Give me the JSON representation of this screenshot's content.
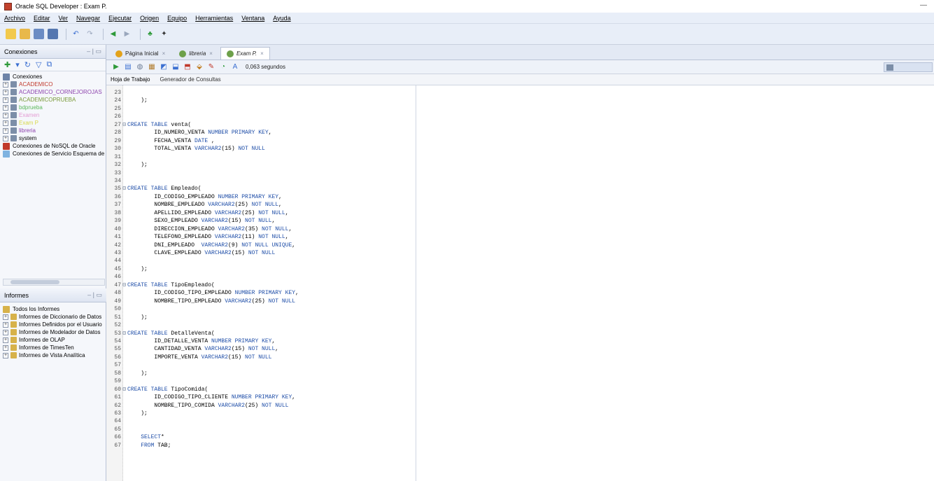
{
  "window": {
    "title": "Oracle SQL Developer : Exam P."
  },
  "menu": [
    "Archivo",
    "Editar",
    "Ver",
    "Navegar",
    "Ejecutar",
    "Origen",
    "Equipo",
    "Herramientas",
    "Ventana",
    "Ayuda"
  ],
  "connections_panel": {
    "title": "Conexiones",
    "root": "Conexiones",
    "items": [
      {
        "label": "ACADEMICO",
        "color": "#c0392b"
      },
      {
        "label": "ACADEMICO_CORNEJOROJAS",
        "color": "#8e44ad"
      },
      {
        "label": "ACADEMICOPRUEBA",
        "color": "#7a9a3a"
      },
      {
        "label": "bdprueba",
        "color": "#5cb85c"
      },
      {
        "label": "Examen",
        "color": "#e39bd3"
      },
      {
        "label": "Exam P",
        "color": "#d8d84a"
      },
      {
        "label": "libreria",
        "color": "#8e44ad"
      },
      {
        "label": "system",
        "color": "#000000"
      }
    ],
    "extra": [
      "Conexiones de NoSQL de Oracle",
      "Conexiones de Servicio Esquema de"
    ]
  },
  "reports_panel": {
    "title": "Informes",
    "root": "Todos los Informes",
    "items": [
      "Informes de Diccionario de Datos",
      "Informes Definidos por el Usuario",
      "Informes de Modelador de Datos",
      "Informes de OLAP",
      "Informes de TimesTen",
      "Informes de Vista Analítica"
    ]
  },
  "tabs": [
    {
      "label": "Página Inicial",
      "active": false
    },
    {
      "label": "libreria",
      "active": false
    },
    {
      "label": "Exam P.",
      "active": true
    }
  ],
  "worksheet": {
    "elapsed": "0,063 segundos",
    "subtabs": [
      "Hoja de Trabajo",
      "Generador de Consultas"
    ],
    "lines": [
      {
        "n": "23",
        "fold": "",
        "text": ""
      },
      {
        "n": "24",
        "fold": "",
        "text": "    );"
      },
      {
        "n": "25",
        "fold": "",
        "text": ""
      },
      {
        "n": "26",
        "fold": "",
        "text": ""
      },
      {
        "n": "27",
        "fold": "⊟",
        "text": "CREATE TABLE venta("
      },
      {
        "n": "28",
        "fold": "",
        "text": "        ID_NUMERO_VENTA NUMBER PRIMARY KEY,"
      },
      {
        "n": "29",
        "fold": "",
        "text": "        FECHA_VENTA DATE ,"
      },
      {
        "n": "30",
        "fold": "",
        "text": "        TOTAL_VENTA VARCHAR2(15) NOT NULL"
      },
      {
        "n": "31",
        "fold": "",
        "text": ""
      },
      {
        "n": "32",
        "fold": "",
        "text": "    );"
      },
      {
        "n": "33",
        "fold": "",
        "text": ""
      },
      {
        "n": "34",
        "fold": "",
        "text": ""
      },
      {
        "n": "35",
        "fold": "⊟",
        "text": "CREATE TABLE Empleado("
      },
      {
        "n": "36",
        "fold": "",
        "text": "        ID_CODIGO_EMPLEADO NUMBER PRIMARY KEY,"
      },
      {
        "n": "37",
        "fold": "",
        "text": "        NOMBRE_EMPLEADO VARCHAR2(25) NOT NULL,"
      },
      {
        "n": "38",
        "fold": "",
        "text": "        APELLIDO_EMPLEADO VARCHAR2(25) NOT NULL,"
      },
      {
        "n": "39",
        "fold": "",
        "text": "        SEXO_EMPLEADO VARCHAR2(15) NOT NULL,"
      },
      {
        "n": "40",
        "fold": "",
        "text": "        DIRECCION_EMPLEADO VARCHAR2(35) NOT NULL,"
      },
      {
        "n": "41",
        "fold": "",
        "text": "        TELEFONO_EMPLEADO VARCHAR2(11) NOT NULL,"
      },
      {
        "n": "42",
        "fold": "",
        "text": "        DNI_EMPLEADO  VARCHAR2(9) NOT NULL UNIQUE,"
      },
      {
        "n": "43",
        "fold": "",
        "text": "        CLAVE_EMPLEADO VARCHAR2(15) NOT NULL"
      },
      {
        "n": "44",
        "fold": "",
        "text": ""
      },
      {
        "n": "45",
        "fold": "",
        "text": "    );"
      },
      {
        "n": "46",
        "fold": "",
        "text": ""
      },
      {
        "n": "47",
        "fold": "⊟",
        "text": "CREATE TABLE TipoEmpleado("
      },
      {
        "n": "48",
        "fold": "",
        "text": "        ID_CODIGO_TIPO_EMPLEADO NUMBER PRIMARY KEY,"
      },
      {
        "n": "49",
        "fold": "",
        "text": "        NOMBRE_TIPO_EMPLEADO VARCHAR2(25) NOT NULL"
      },
      {
        "n": "50",
        "fold": "",
        "text": ""
      },
      {
        "n": "51",
        "fold": "",
        "text": "    );"
      },
      {
        "n": "52",
        "fold": "",
        "text": ""
      },
      {
        "n": "53",
        "fold": "⊟",
        "text": "CREATE TABLE DetalleVenta("
      },
      {
        "n": "54",
        "fold": "",
        "text": "        ID_DETALLE_VENTA NUMBER PRIMARY KEY,"
      },
      {
        "n": "55",
        "fold": "",
        "text": "        CANTIDAD_VENTA VARCHAR2(15) NOT NULL,"
      },
      {
        "n": "56",
        "fold": "",
        "text": "        IMPORTE_VENTA VARCHAR2(15) NOT NULL"
      },
      {
        "n": "57",
        "fold": "",
        "text": ""
      },
      {
        "n": "58",
        "fold": "",
        "text": "    );"
      },
      {
        "n": "59",
        "fold": "",
        "text": ""
      },
      {
        "n": "60",
        "fold": "⊟",
        "text": "CREATE TABLE TipoComida("
      },
      {
        "n": "61",
        "fold": "",
        "text": "        ID_CODIGO_TIPO_CLIENTE NUMBER PRIMARY KEY,"
      },
      {
        "n": "62",
        "fold": "",
        "text": "        NOMBRE_TIPO_COMIDA VARCHAR2(25) NOT NULL"
      },
      {
        "n": "63",
        "fold": "",
        "text": "    );"
      },
      {
        "n": "64",
        "fold": "",
        "text": ""
      },
      {
        "n": "65",
        "fold": "",
        "text": ""
      },
      {
        "n": "66",
        "fold": "",
        "text": "    SELECT*"
      },
      {
        "n": "67",
        "fold": "",
        "text": "    FROM TAB;"
      }
    ]
  },
  "colors": {
    "keyword": "#1f4ea8",
    "chrome": "#e8eef8"
  }
}
